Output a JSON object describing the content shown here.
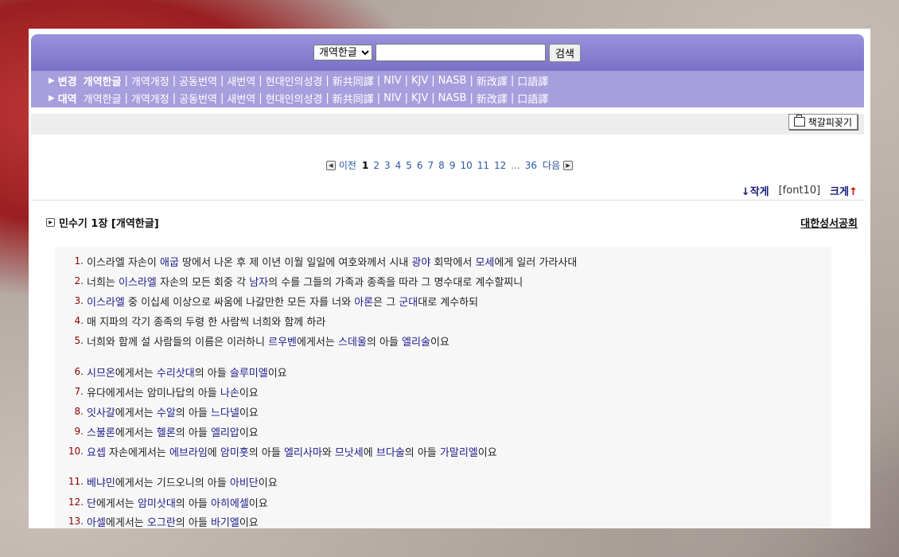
{
  "search": {
    "version_selected": "개역한글",
    "button_label": "검색",
    "query": ""
  },
  "versions_row": {
    "label": "변경",
    "items": [
      "개역한글",
      "개역개정",
      "공동번역",
      "새번역",
      "현대인의성경",
      "新共同譯",
      "NIV",
      "KJV",
      "NASB",
      "新改譯",
      "口語譯"
    ],
    "active": "개역한글"
  },
  "parallel_row": {
    "label": "대역",
    "items": [
      "개역한글",
      "개역개정",
      "공동번역",
      "새번역",
      "현대인의성경",
      "新共同譯",
      "NIV",
      "KJV",
      "NASB",
      "新改譯",
      "口語譯"
    ]
  },
  "toolbar": {
    "bookmark_label": "책갈피꽂기"
  },
  "pagination": {
    "prev": "이전",
    "next": "다음",
    "pages": [
      "1",
      "2",
      "3",
      "4",
      "5",
      "6",
      "7",
      "8",
      "9",
      "10",
      "11",
      "12"
    ],
    "dots": "...",
    "last": "36",
    "current": "1"
  },
  "font_controls": {
    "smaller": "작게",
    "size": "[font10]",
    "bigger": "크게",
    "smaller_arrow": "↓",
    "bigger_arrow": "↑"
  },
  "chapter": {
    "title": "민수기 1장 [개역한글]",
    "publisher": "대한성서공회"
  },
  "verses": [
    {
      "num": "1.",
      "parts": [
        [
          "이스라엘 자손이 ",
          0
        ],
        [
          "애굽",
          1
        ],
        [
          " 땅에서 나온 후 제 이년 이월 일일에 여호와께서 시내 ",
          0
        ],
        [
          "광야",
          1
        ],
        [
          " 회막에서 ",
          0
        ],
        [
          "모세",
          1
        ],
        [
          "에게 일러 가라사대",
          0
        ]
      ]
    },
    {
      "num": "2.",
      "parts": [
        [
          "너희는 ",
          0
        ],
        [
          "이스라엘",
          1
        ],
        [
          " 자손의 모든 회중 각 ",
          0
        ],
        [
          "남자",
          1
        ],
        [
          "의 수를 그들의 가족과 종족을 따라 그 명수대로 계수할찌니",
          0
        ]
      ]
    },
    {
      "num": "3.",
      "parts": [
        [
          "이스라엘",
          1
        ],
        [
          " 중 이십세 이상으로 싸움에 나갈만한 모든 자를 너와 ",
          0
        ],
        [
          "아론",
          1
        ],
        [
          "은 그 ",
          0
        ],
        [
          "군대",
          1
        ],
        [
          "대로 계수하되",
          0
        ]
      ]
    },
    {
      "num": "4.",
      "parts": [
        [
          "매 지파의 각기 종족의 두령 한 사람씩 너희와 함께 하라",
          0
        ]
      ]
    },
    {
      "num": "5.",
      "parts": [
        [
          "너희와 함께 설 사람들의 이름은 이러하니 ",
          0
        ],
        [
          "르우벤",
          1
        ],
        [
          "에게서는 ",
          0
        ],
        [
          "스데울",
          1
        ],
        [
          "의 아들 ",
          0
        ],
        [
          "엘리술",
          1
        ],
        [
          "이요",
          0
        ]
      ]
    },
    {
      "num": "6.",
      "parts": [
        [
          "시므온",
          1
        ],
        [
          "에게서는 ",
          0
        ],
        [
          "수리삿대",
          1
        ],
        [
          "의 아들 ",
          0
        ],
        [
          "슬루미엘",
          1
        ],
        [
          "이요",
          0
        ]
      ]
    },
    {
      "num": "7.",
      "parts": [
        [
          "유다에게서는 암미나답의 아들 ",
          0
        ],
        [
          "나손",
          1
        ],
        [
          "이요",
          0
        ]
      ]
    },
    {
      "num": "8.",
      "parts": [
        [
          "잇사갈",
          1
        ],
        [
          "에게서는 ",
          0
        ],
        [
          "수알",
          1
        ],
        [
          "의 아들 ",
          0
        ],
        [
          "느다넬",
          1
        ],
        [
          "이요",
          0
        ]
      ]
    },
    {
      "num": "9.",
      "parts": [
        [
          "스불론",
          1
        ],
        [
          "에게서는 ",
          0
        ],
        [
          "헬론",
          1
        ],
        [
          "의 아들 ",
          0
        ],
        [
          "엘리압",
          1
        ],
        [
          "이요",
          0
        ]
      ]
    },
    {
      "num": "10.",
      "parts": [
        [
          "요셉",
          1
        ],
        [
          " 자손에게서는 ",
          0
        ],
        [
          "에브라임",
          1
        ],
        [
          "에 ",
          0
        ],
        [
          "암미훗",
          1
        ],
        [
          "의 아들 ",
          0
        ],
        [
          "엘리사마",
          1
        ],
        [
          "와 ",
          0
        ],
        [
          "므낫세",
          1
        ],
        [
          "에 ",
          0
        ],
        [
          "브다술",
          1
        ],
        [
          "의 아들 ",
          0
        ],
        [
          "가말리엘",
          1
        ],
        [
          "이요",
          0
        ]
      ]
    },
    {
      "num": "11.",
      "parts": [
        [
          "베냐민",
          1
        ],
        [
          "에게서는 기드오니의 아들 ",
          0
        ],
        [
          "아비단",
          1
        ],
        [
          "이요",
          0
        ]
      ]
    },
    {
      "num": "12.",
      "parts": [
        [
          "단",
          1
        ],
        [
          "에게서는 ",
          0
        ],
        [
          "암미삿대",
          1
        ],
        [
          "의 아들 ",
          0
        ],
        [
          "아히에셀",
          1
        ],
        [
          "이요",
          0
        ]
      ]
    },
    {
      "num": "13.",
      "parts": [
        [
          "아셀",
          1
        ],
        [
          "에게서는 ",
          0
        ],
        [
          "오그란",
          1
        ],
        [
          "의 아들 ",
          0
        ],
        [
          "바기엘",
          1
        ],
        [
          "이요",
          0
        ]
      ]
    }
  ],
  "colors": {
    "header_top": "#8a82d4",
    "header_links": "#a79fdd",
    "name_link": "#1c1c8c",
    "verse_num": "#8b0000"
  }
}
